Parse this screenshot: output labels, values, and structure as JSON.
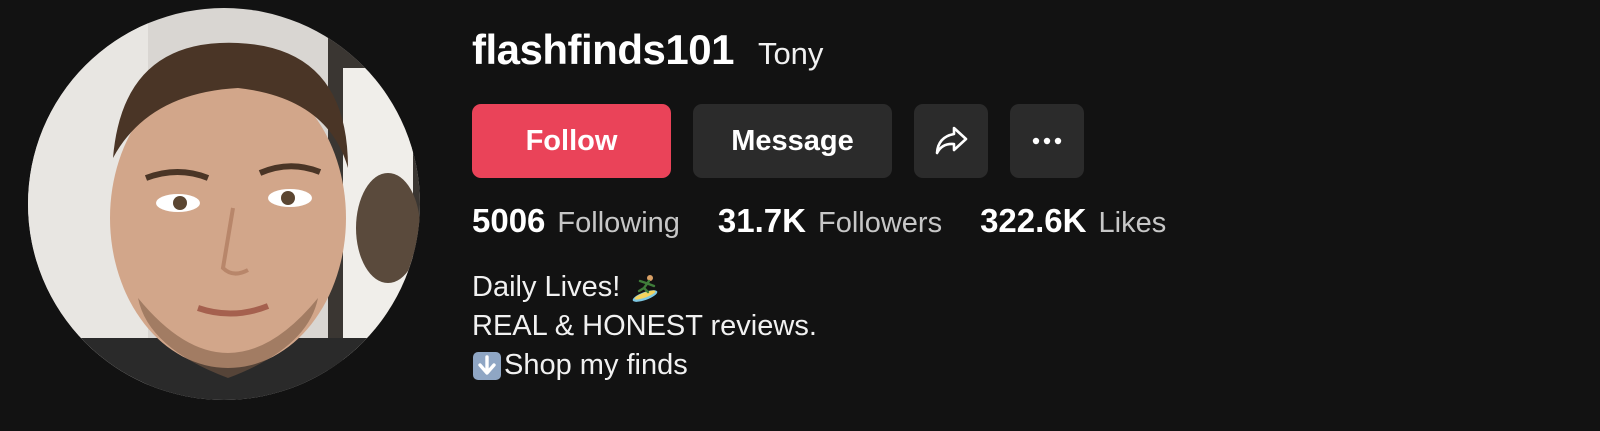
{
  "profile": {
    "username": "flashfinds101",
    "nickname": "Tony",
    "avatar_icon": "profile-photo"
  },
  "actions": {
    "follow_label": "Follow",
    "message_label": "Message",
    "share_icon": "share-arrow-icon",
    "more_icon": "more-dots-icon"
  },
  "stats": [
    {
      "value": "5006",
      "label": "Following"
    },
    {
      "value": "31.7K",
      "label": "Followers"
    },
    {
      "value": "322.6K",
      "label": "Likes"
    }
  ],
  "bio": {
    "line1": "Daily Lives!",
    "line1_emoji": "surfer-emoji",
    "line2": "REAL & HONEST reviews.",
    "line3": "Shop my finds",
    "line3_emoji": "down-arrow-emoji"
  },
  "colors": {
    "background": "#121212",
    "follow": "#ea4359",
    "secondary_button": "#2b2b2b"
  }
}
